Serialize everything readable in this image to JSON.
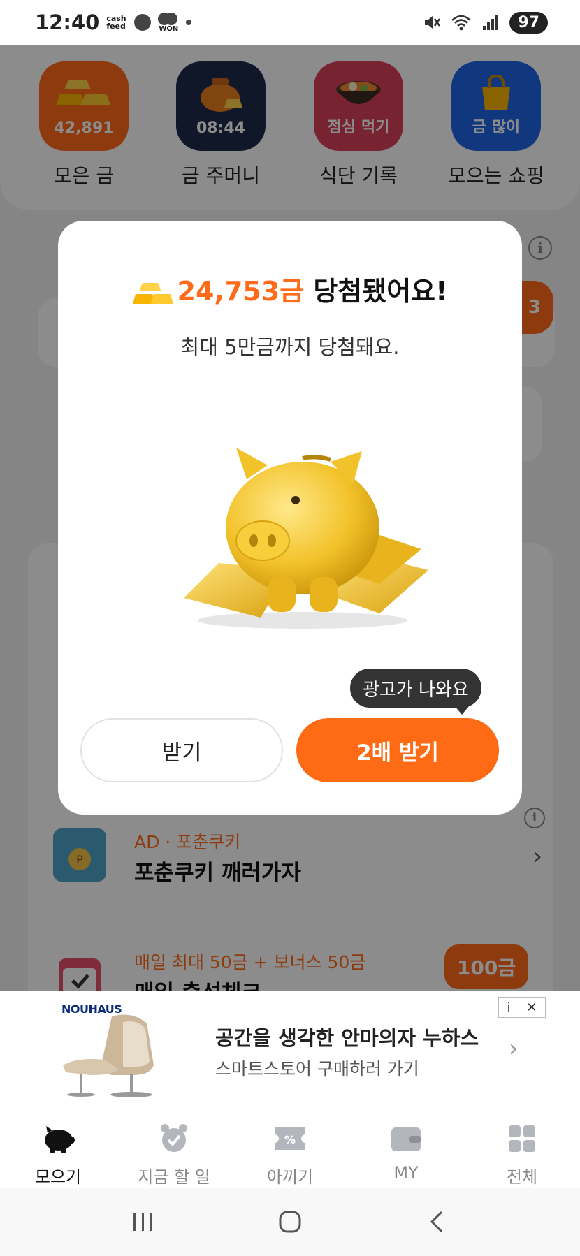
{
  "status_bar": {
    "time": "12:40",
    "notif_cashfeed": "cash feed",
    "notif_won": "WON",
    "battery": "97"
  },
  "shortcuts": [
    {
      "value": "42,891",
      "label": "모은 금",
      "color": "#ff6b1a",
      "icon": "gold-bars-icon"
    },
    {
      "value": "08:44",
      "label": "금 주머니",
      "color": "#1e2a4a",
      "icon": "money-pouch-icon"
    },
    {
      "value": "점심 먹기",
      "label": "식단 기록",
      "color": "#d9415a",
      "icon": "hot-pot-icon"
    },
    {
      "value": "금 많이",
      "label": "모으는 쇼핑",
      "color": "#1f66e8",
      "icon": "shopping-bag-icon"
    }
  ],
  "background": {
    "badge_partial": "3",
    "fortune_item": {
      "sub": "AD · 포춘쿠키",
      "title": "포춘쿠키 깨러가자"
    },
    "attendance_item": {
      "sub": "매일 최대 50금 + 보너스 50금",
      "title": "매일 출석체크",
      "reward": "100금"
    }
  },
  "modal": {
    "amount": "24,753금",
    "title_suffix": " 당첨됐어요!",
    "subtitle": "최대 5만금까지 당첨돼요.",
    "tooltip": "광고가 나와요",
    "receive_label": "받기",
    "double_label": "2배 받기",
    "accent": "#ff6a14"
  },
  "ad_banner": {
    "brand": "NOUHAUS",
    "headline": "공간을 생각한 안마의자 누하스",
    "cta": "스마트스토어 구매하러 가기",
    "adchoices_i": "i",
    "adchoices_x": "✕"
  },
  "bottom_nav": [
    {
      "label": "모으기",
      "icon": "piggy-icon",
      "active": true
    },
    {
      "label": "지금 할 일",
      "icon": "alarm-clock-icon",
      "active": false
    },
    {
      "label": "아끼기",
      "icon": "coupon-icon",
      "active": false
    },
    {
      "label": "MY",
      "icon": "wallet-icon",
      "active": false
    },
    {
      "label": "전체",
      "icon": "grid-icon",
      "active": false
    }
  ]
}
